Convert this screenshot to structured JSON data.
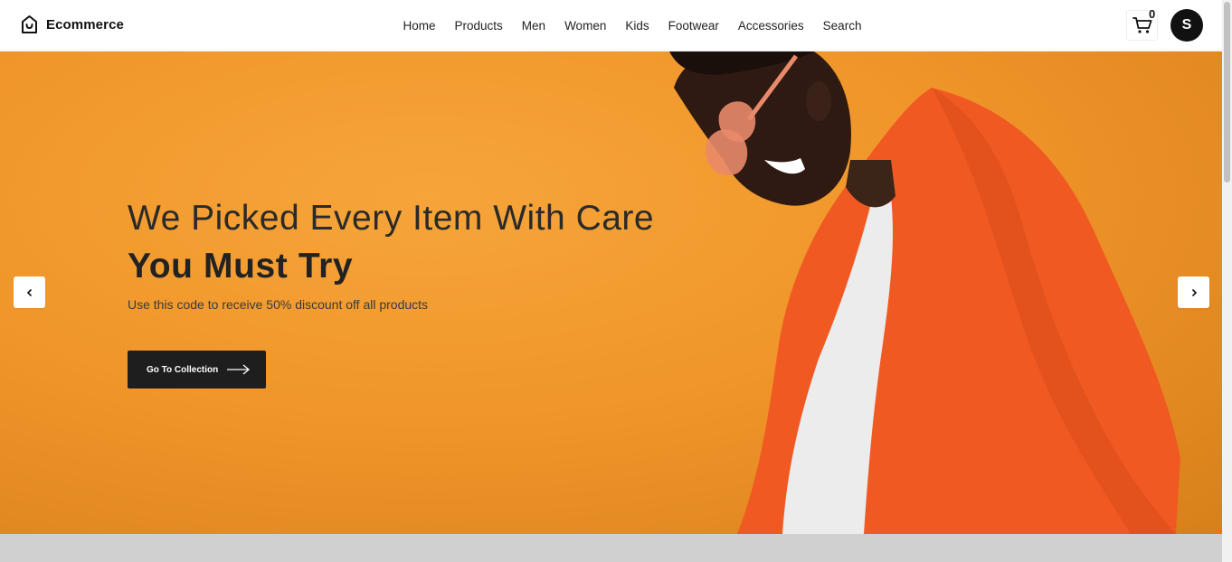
{
  "brand": {
    "name": "Ecommerce",
    "icon": "shopping-bag-icon"
  },
  "nav": {
    "items": [
      {
        "label": "Home"
      },
      {
        "label": "Products"
      },
      {
        "label": "Men"
      },
      {
        "label": "Women"
      },
      {
        "label": "Kids"
      },
      {
        "label": "Footwear"
      },
      {
        "label": "Accessories"
      },
      {
        "label": "Search"
      }
    ]
  },
  "cart": {
    "count": "0",
    "icon": "cart-icon"
  },
  "user": {
    "initial": "S"
  },
  "hero": {
    "title": "We Picked Every Item With Care",
    "subtitle": "You Must Try",
    "text": "Use this code to receive 50% discount off all products",
    "cta_label": "Go To Collection",
    "prev_icon": "chevron-left-icon",
    "next_icon": "chevron-right-icon"
  },
  "colors": {
    "hero_bg": "#f0962a",
    "jacket": "#f05a22",
    "cta_bg": "#1e1e1e",
    "avatar_bg": "#111111"
  }
}
